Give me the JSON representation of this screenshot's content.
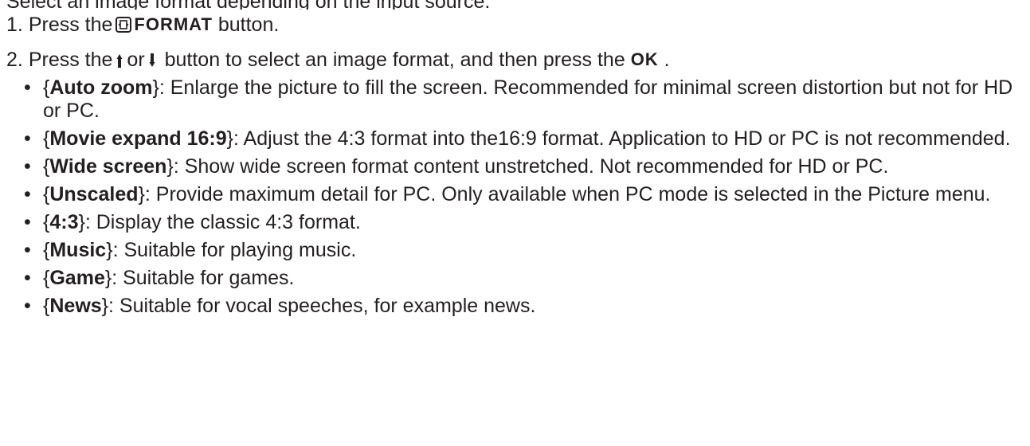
{
  "header": {
    "cut_text": "Select an image format depending on the input source."
  },
  "steps": [
    {
      "number": "1.",
      "before": "Press the",
      "keyword": "FORMAT",
      "after": "button."
    },
    {
      "number": "2.",
      "before": "Press the",
      "or_word": "or",
      "middle": "button to select an image format, and then press the",
      "ok_label": "OK",
      "after": "."
    }
  ],
  "formats": [
    {
      "open": "{",
      "name": "Auto zoom",
      "close": "}",
      "desc": ": Enlarge the picture to fill the screen. Recommended for minimal screen distortion but not for HD or PC."
    },
    {
      "open": "{",
      "name": "Movie expand 16:9",
      "close": "}",
      "desc": ": Adjust the 4:3 format into the16:9 format. Application to HD or PC is not recommended."
    },
    {
      "open": "{",
      "name": "Wide screen",
      "close": "}",
      "desc": ": Show wide screen format content unstretched. Not recommended for HD or PC."
    },
    {
      "open": "{",
      "name": "Unscaled",
      "close": "}",
      "desc": ": Provide maximum detail for PC. Only available when PC mode is selected in the Picture menu."
    },
    {
      "open": "{",
      "name": "4:3",
      "close": "}",
      "desc": ": Display the classic 4:3 format."
    },
    {
      "open": "{",
      "name": "Music",
      "close": "}",
      "desc": ": Suitable for playing music."
    },
    {
      "open": "{",
      "name": "Game",
      "close": "}",
      "desc": ": Suitable for games."
    },
    {
      "open": "{",
      "name": "News",
      "close": "}",
      "desc": ": Suitable for vocal speeches, for example news."
    }
  ],
  "bullet_char": "•",
  "icons": {
    "format": "format-button-icon",
    "up": "up-arrow-icon",
    "down": "down-arrow-icon"
  }
}
